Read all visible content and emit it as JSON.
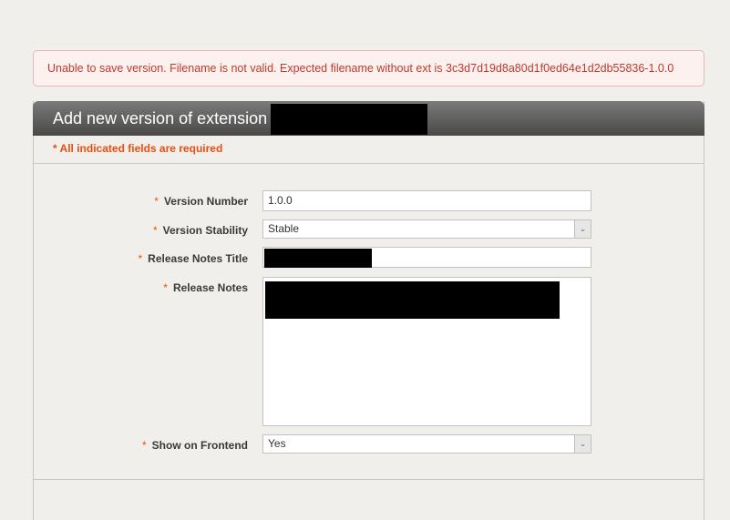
{
  "error": {
    "message": "Unable to save version. Filename is not valid. Expected filename without ext is 3c3d7d19d8a80d1f0ed64e1d2db55836-1.0.0"
  },
  "panel": {
    "title": "Add new version of extension",
    "required_note": "* All indicated fields are required"
  },
  "form": {
    "required_marker": "*",
    "version_number": {
      "label": "Version Number",
      "value": "1.0.0"
    },
    "version_stability": {
      "label": "Version Stability",
      "value": "Stable"
    },
    "release_notes_title": {
      "label": "Release Notes Title",
      "value": ""
    },
    "release_notes": {
      "label": "Release Notes",
      "value": ""
    },
    "show_on_frontend": {
      "label": "Show on Frontend",
      "value": "Yes"
    },
    "dropdown_icon": "chevron-down-icon"
  },
  "colors": {
    "error_text": "#c0392b",
    "required_accent": "#eb5202",
    "header_dark": "#4a4948"
  }
}
